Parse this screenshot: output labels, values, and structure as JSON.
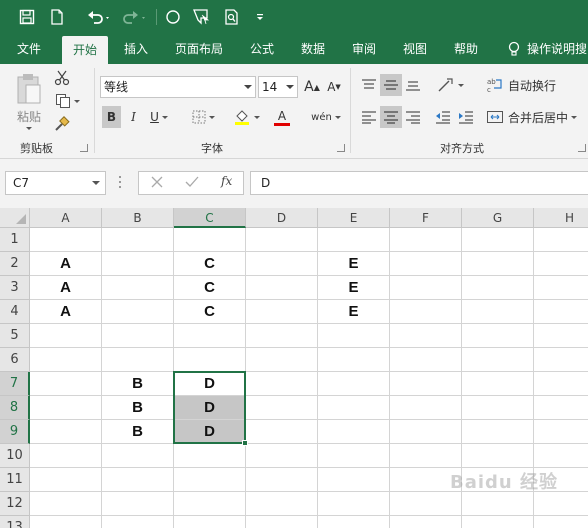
{
  "quick_access": {
    "icons": [
      "save-icon",
      "new-file-icon",
      "undo-icon",
      "redo-icon",
      "circle-shape-icon",
      "touch-mode-icon",
      "print-preview-icon",
      "customize-icon"
    ]
  },
  "menu": {
    "tabs": [
      "文件",
      "开始",
      "插入",
      "页面布局",
      "公式",
      "数据",
      "审阅",
      "视图",
      "帮助"
    ],
    "active": "开始",
    "tell_me": "操作说明搜"
  },
  "ribbon": {
    "clipboard": {
      "paste_label": "粘贴",
      "group_label": "剪贴板"
    },
    "font": {
      "name": "等线",
      "size": "14",
      "bold": "B",
      "italic": "I",
      "underline": "U",
      "font_color_glyph": "A",
      "grow_glyph": "A",
      "shrink_glyph": "A",
      "phonetic_glyph": "wén",
      "group_label": "字体"
    },
    "alignment": {
      "wrap_text": "自动换行",
      "merge_center": "合并后居中",
      "group_label": "对齐方式"
    }
  },
  "formula_bar": {
    "name_box": "C7",
    "fx_label": "fx",
    "value": "D"
  },
  "sheet": {
    "columns": [
      "A",
      "B",
      "C",
      "D",
      "E",
      "F",
      "G",
      "H"
    ],
    "rows": [
      "1",
      "2",
      "3",
      "4",
      "5",
      "6",
      "7",
      "8",
      "9",
      "10",
      "11",
      "12",
      "13"
    ],
    "active_column": "C",
    "active_rows": [
      "7",
      "8",
      "9"
    ],
    "active_cell": "C7",
    "selection": [
      "C7",
      "C8",
      "C9"
    ],
    "cells": {
      "A2": "A",
      "C2": "C",
      "E2": "E",
      "A3": "A",
      "C3": "C",
      "E3": "E",
      "A4": "A",
      "C4": "C",
      "E4": "E",
      "B7": "B",
      "C7": "D",
      "B8": "B",
      "C8": "D",
      "B9": "B",
      "C9": "D"
    }
  },
  "colors": {
    "accent": "#217346",
    "selection_fill": "#c6c6c6"
  },
  "watermark": "Baidu 经验"
}
